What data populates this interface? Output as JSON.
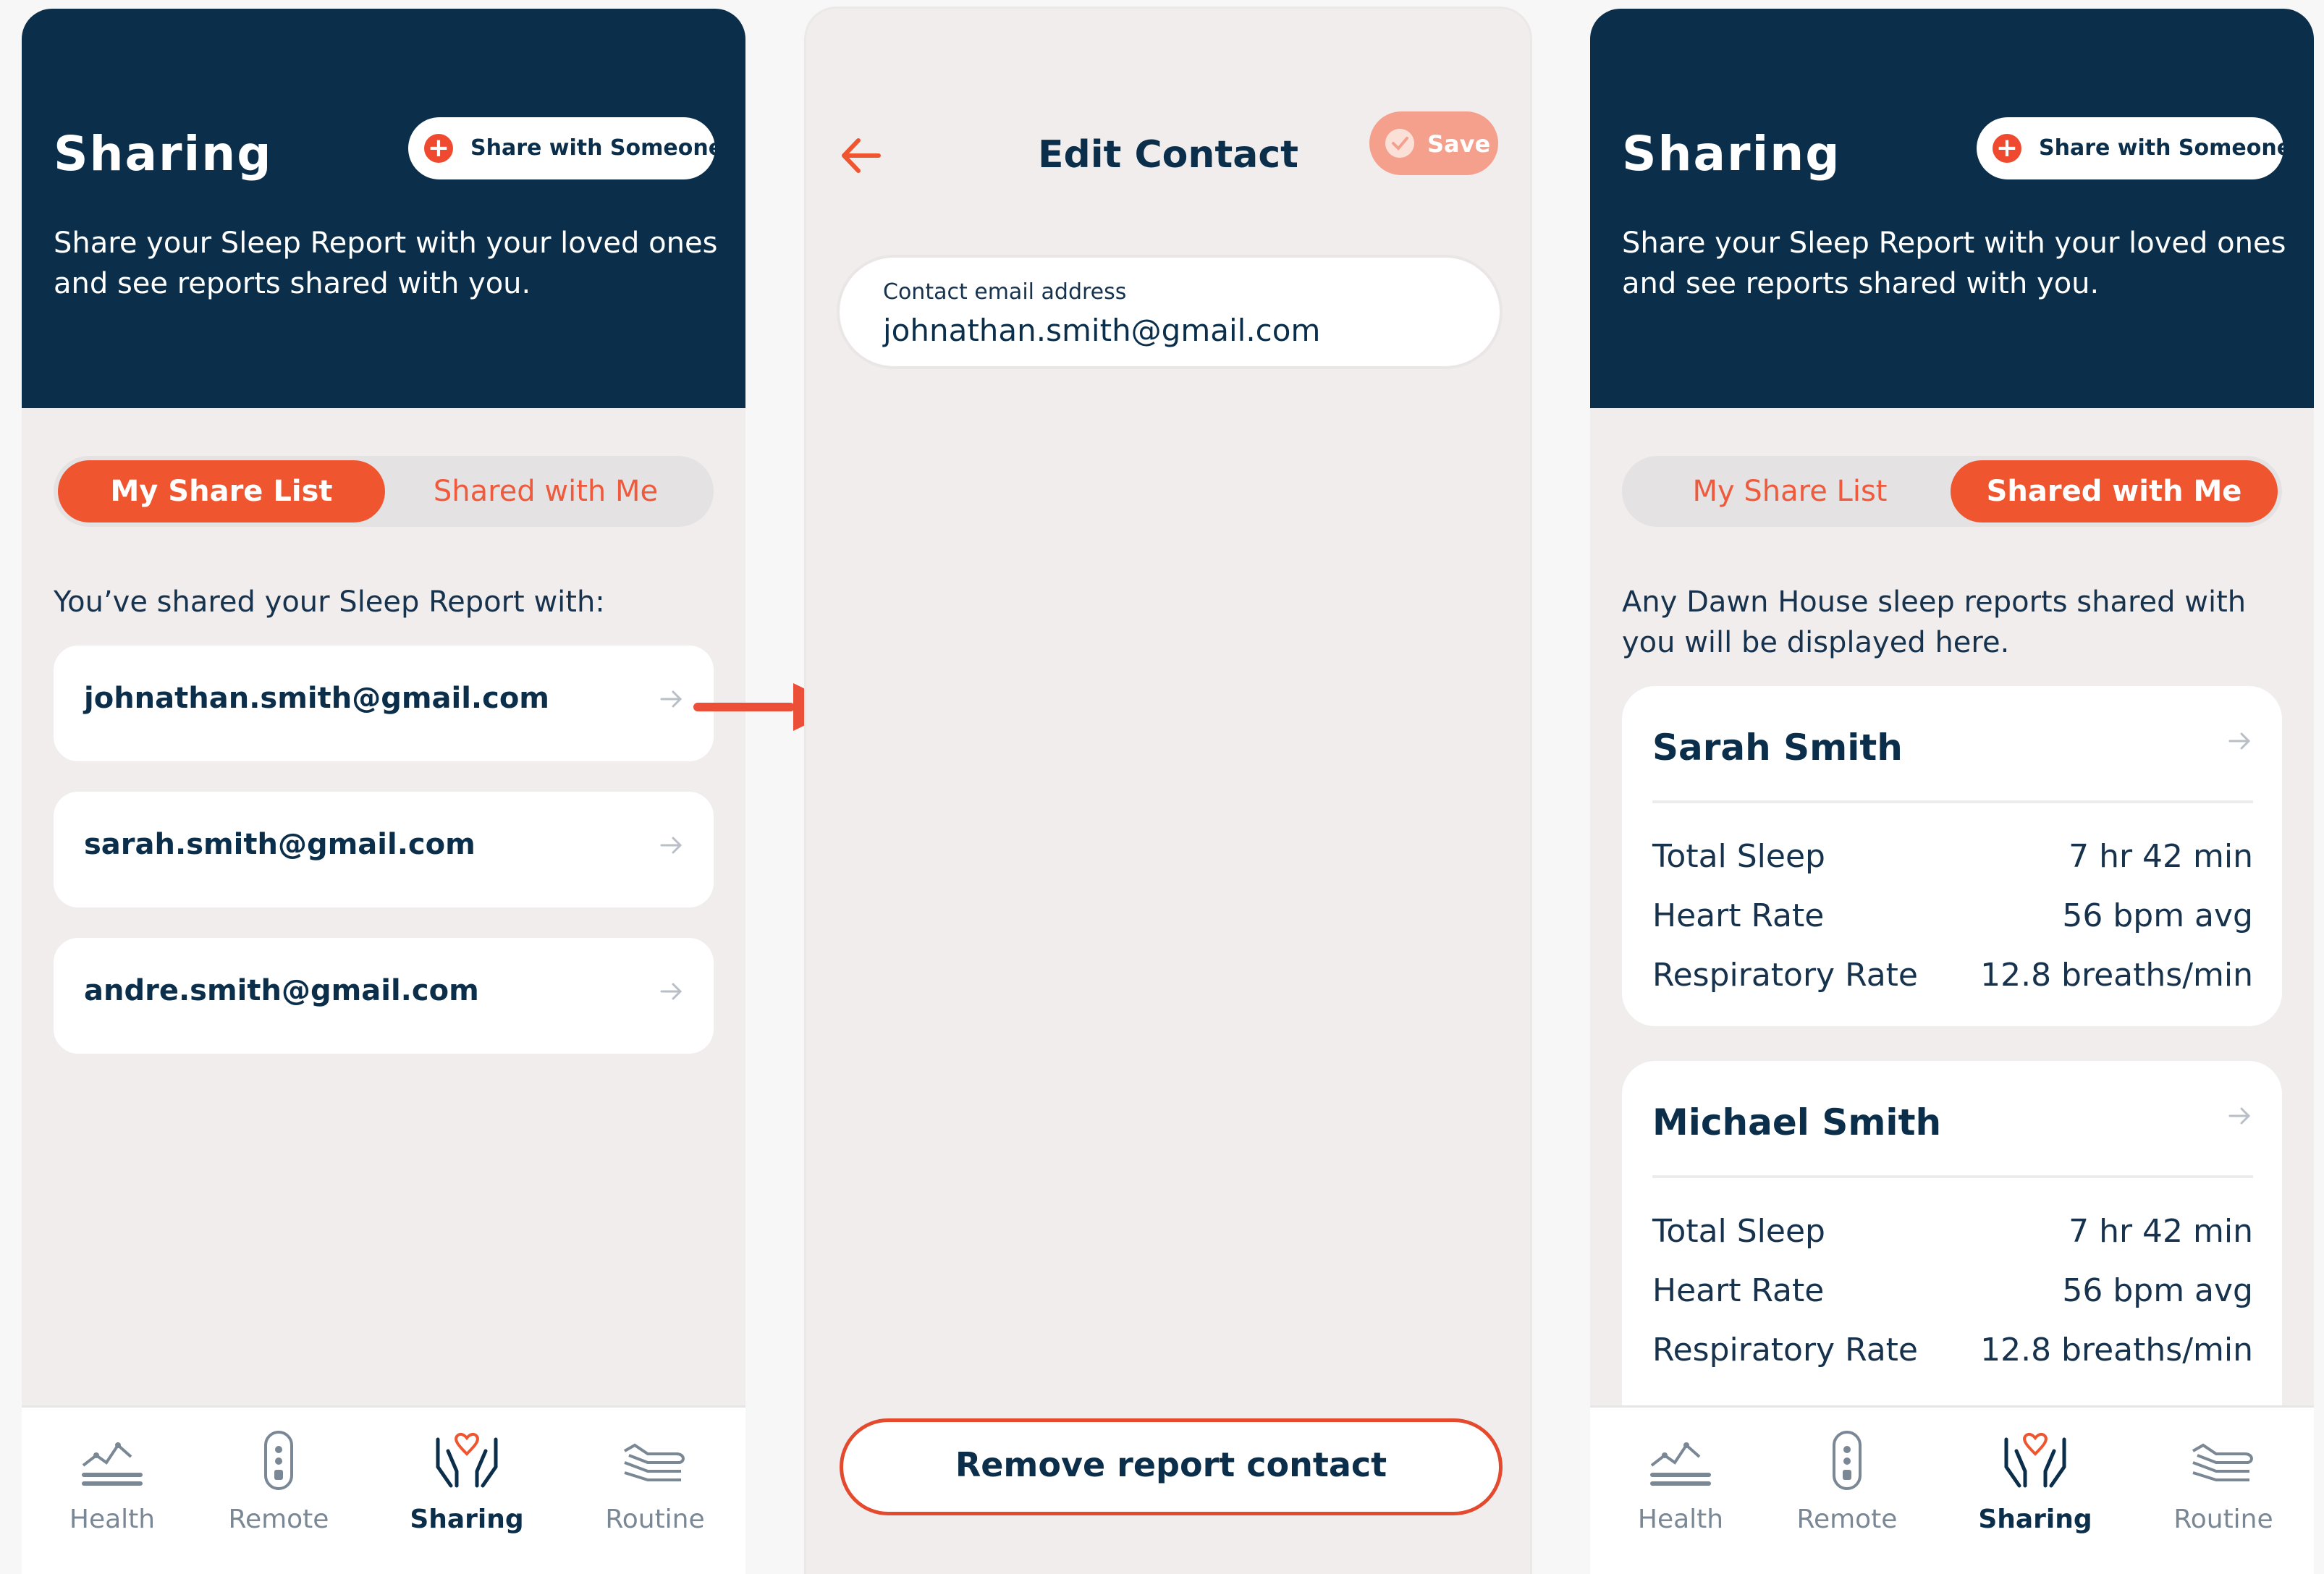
{
  "colors": {
    "navy": "#0b2f4a",
    "accent": "#ef5630",
    "arrow": "#ec4f38",
    "background": "#f1eded"
  },
  "screen1": {
    "header": {
      "title": "Sharing",
      "share_button": "Share with Someone",
      "description": "Share your Sleep Report with your loved ones and see reports shared with you."
    },
    "tabs": {
      "my_share_list": "My Share List",
      "shared_with_me": "Shared with Me",
      "selected": "My Share List"
    },
    "intro": "You’ve shared your Sleep Report with:",
    "contacts": [
      "johnathan.smith@gmail.com",
      "sarah.smith@gmail.com",
      "andre.smith@gmail.com"
    ]
  },
  "screen2": {
    "title": "Edit Contact",
    "save_label": "Save",
    "field_label": "Contact email address",
    "field_value": "johnathan.smith@gmail.com",
    "remove_label": "Remove report contact"
  },
  "screen3": {
    "header": {
      "title": "Sharing",
      "share_button": "Share with Someone",
      "description": "Share your Sleep Report with your loved ones and see reports shared with you."
    },
    "tabs": {
      "my_share_list": "My Share List",
      "shared_with_me": "Shared with Me",
      "selected": "Shared with Me"
    },
    "intro": "Any Dawn House sleep reports shared with you will be displayed here.",
    "reports": [
      {
        "name": "Sarah Smith",
        "metrics": [
          {
            "label": "Total Sleep",
            "value": "7 hr 42 min"
          },
          {
            "label": "Heart Rate",
            "value": "56 bpm avg"
          },
          {
            "label": "Respiratory Rate",
            "value": "12.8 breaths/min"
          }
        ]
      },
      {
        "name": "Michael Smith",
        "metrics": [
          {
            "label": "Total Sleep",
            "value": "7 hr 42 min"
          },
          {
            "label": "Heart Rate",
            "value": "56 bpm avg"
          },
          {
            "label": "Respiratory Rate",
            "value": "12.8 breaths/min"
          }
        ]
      }
    ]
  },
  "tabbar": {
    "items": [
      {
        "label": "Health",
        "icon": "health-chart-icon"
      },
      {
        "label": "Remote",
        "icon": "remote-icon"
      },
      {
        "label": "Sharing",
        "icon": "sharing-hands-heart-icon"
      },
      {
        "label": "Routine",
        "icon": "routine-bed-icon"
      }
    ],
    "active": "Sharing"
  }
}
